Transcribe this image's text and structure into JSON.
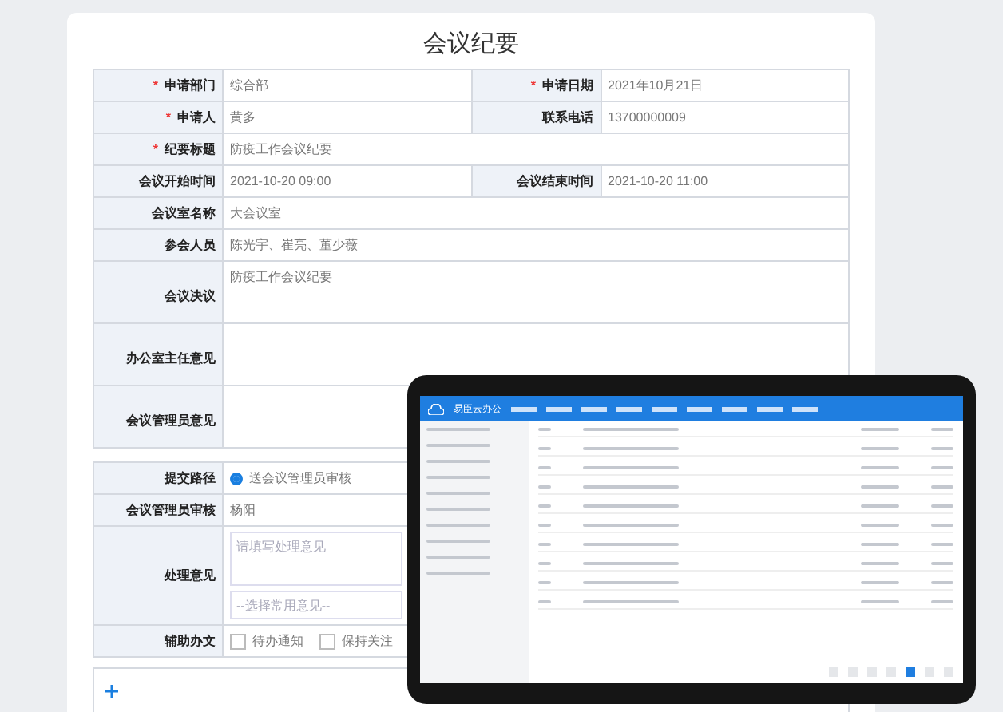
{
  "form": {
    "title": "会议纪要",
    "rows": [
      {
        "fields": [
          {
            "label": "申请部门",
            "required_mark": "*",
            "value": "综合部"
          },
          {
            "label": "申请日期",
            "required_mark": "*",
            "value": "2021年10月21日"
          }
        ]
      },
      {
        "fields": [
          {
            "label": "申请人",
            "required_mark": "*",
            "value": "黄多"
          },
          {
            "label": "联系电话",
            "value": "13700000009"
          }
        ]
      },
      {
        "fields": [
          {
            "label": "纪要标题",
            "required_mark": "*",
            "value": "防疫工作会议纪要"
          }
        ]
      },
      {
        "fields": [
          {
            "label": "会议开始时间",
            "value": "2021-10-20 09:00"
          },
          {
            "label": "会议结束时间",
            "value": "2021-10-20 11:00"
          }
        ]
      },
      {
        "fields": [
          {
            "label": "会议室名称",
            "value": "大会议室"
          }
        ]
      },
      {
        "fields": [
          {
            "label": "参会人员",
            "value": "陈光宇、崔亮、董少薇"
          }
        ]
      },
      {
        "fields": [
          {
            "label": "会议决议",
            "value": "防疫工作会议纪要"
          }
        ]
      },
      {
        "fields": [
          {
            "label": "办公室主任意见"
          }
        ]
      },
      {
        "fields": [
          {
            "label": "会议管理员意见"
          }
        ]
      }
    ]
  },
  "approval": {
    "route": {
      "label": "提交路径",
      "option": "送会议管理员审核",
      "selected": true
    },
    "reviewer": {
      "label": "会议管理员审核",
      "value": "杨阳"
    },
    "opinion": {
      "label": "处理意见",
      "placeholder": "请填写处理意见",
      "select": "--选择常用意见--"
    },
    "assist": {
      "label": "辅助办文",
      "options": [
        {
          "label": "待办通知",
          "checked": false
        },
        {
          "label": "保持关注",
          "checked": false
        }
      ]
    }
  },
  "tablet": {
    "app_name": "易臣云办公",
    "pages": [
      {
        "selected": false
      },
      {
        "selected": false
      },
      {
        "selected": false
      },
      {
        "selected": false
      },
      {
        "selected": true
      },
      {
        "selected": false
      },
      {
        "selected": false
      }
    ]
  }
}
